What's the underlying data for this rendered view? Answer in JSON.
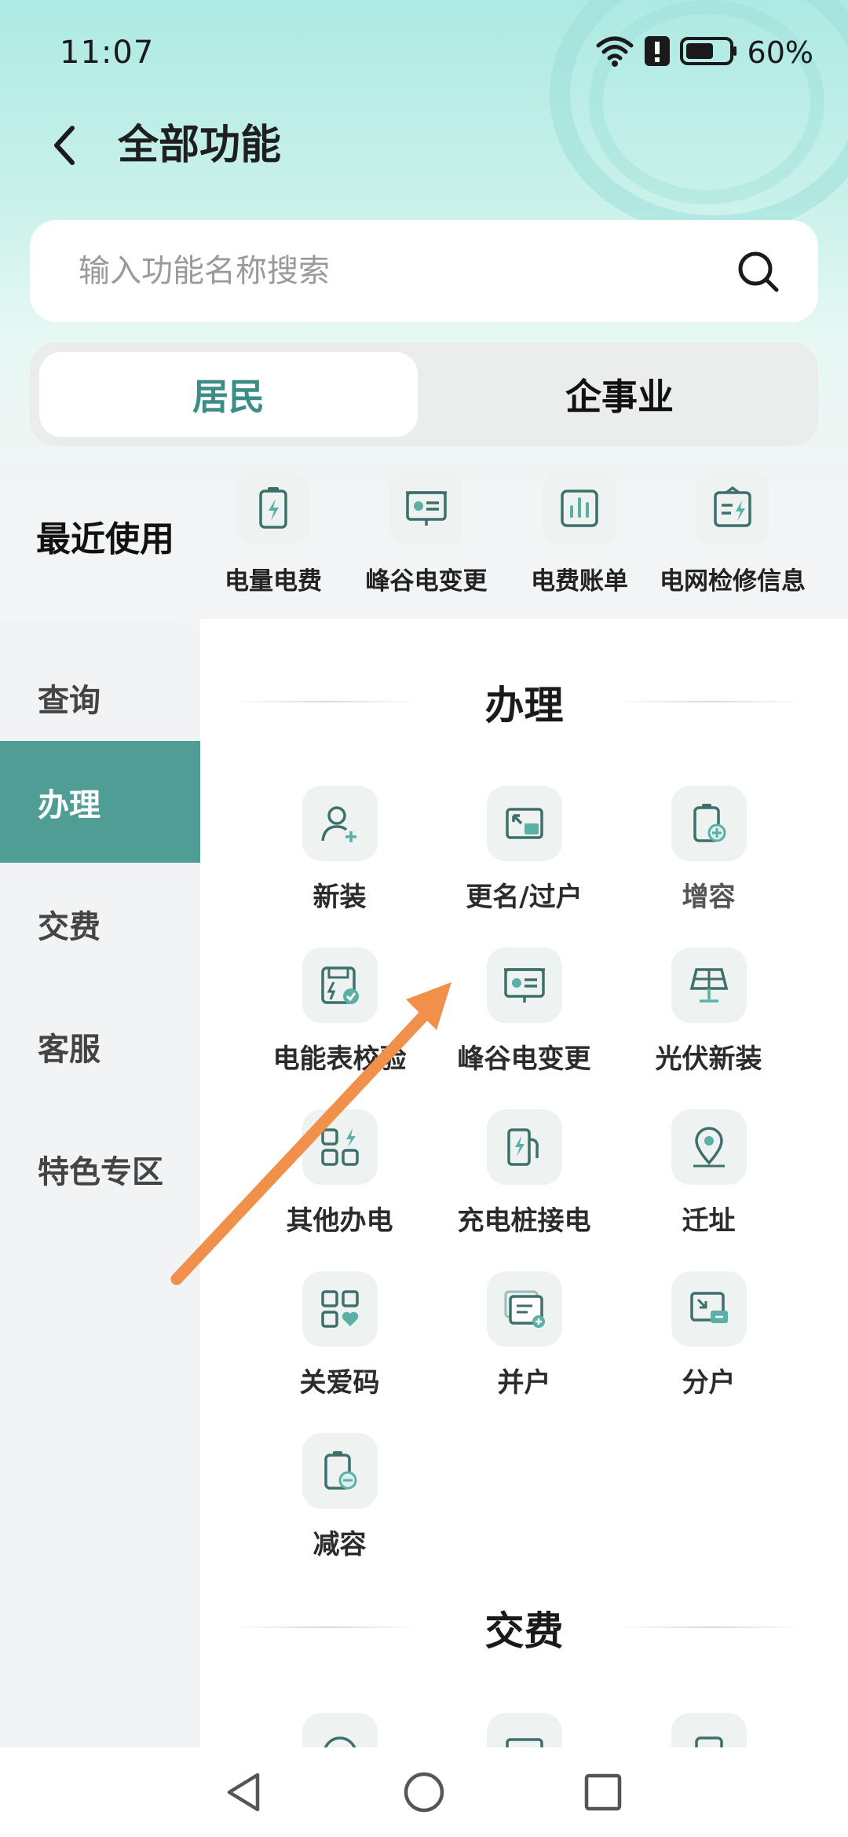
{
  "status_bar": {
    "time": "11:07",
    "battery": "60%"
  },
  "header": {
    "title": "全部功能"
  },
  "search": {
    "placeholder": "输入功能名称搜索"
  },
  "tabs": {
    "resident": "居民",
    "enterprise": "企事业"
  },
  "recent": {
    "label": "最近使用",
    "items": [
      {
        "label": "电量电费",
        "icon": "battery-bolt-icon"
      },
      {
        "label": "峰谷电变更",
        "icon": "monitor-card-icon"
      },
      {
        "label": "电费账单",
        "icon": "bar-chart-icon"
      },
      {
        "label": "电网检修信息",
        "icon": "clipboard-bolt-icon"
      }
    ]
  },
  "sidebar": {
    "items": [
      {
        "label": "查询"
      },
      {
        "label": "办理"
      },
      {
        "label": "交费"
      },
      {
        "label": "客服"
      },
      {
        "label": "特色专区"
      }
    ],
    "active_index": 1
  },
  "sections": {
    "handle": {
      "title": "办理",
      "items": [
        {
          "label": "新装",
          "icon": "user-add-icon"
        },
        {
          "label": "更名/过户",
          "icon": "transfer-icon"
        },
        {
          "label": "增容",
          "icon": "battery-plus-icon"
        },
        {
          "label": "电能表校验",
          "icon": "meter-check-icon"
        },
        {
          "label": "峰谷电变更",
          "icon": "monitor-card-icon"
        },
        {
          "label": "光伏新装",
          "icon": "solar-panel-icon"
        },
        {
          "label": "其他办电",
          "icon": "grid-bolt-icon"
        },
        {
          "label": "充电桩接电",
          "icon": "charging-pile-icon"
        },
        {
          "label": "迁址",
          "icon": "location-pin-icon"
        },
        {
          "label": "关爱码",
          "icon": "qr-heart-icon"
        },
        {
          "label": "并户",
          "icon": "merge-account-icon"
        },
        {
          "label": "分户",
          "icon": "split-account-icon"
        },
        {
          "label": "减容",
          "icon": "battery-minus-icon"
        }
      ]
    },
    "pay": {
      "title": "交费"
    }
  },
  "colors": {
    "accent": "#4f9d95",
    "accent_text": "#3c8d87",
    "arrow": "#f0904a"
  }
}
